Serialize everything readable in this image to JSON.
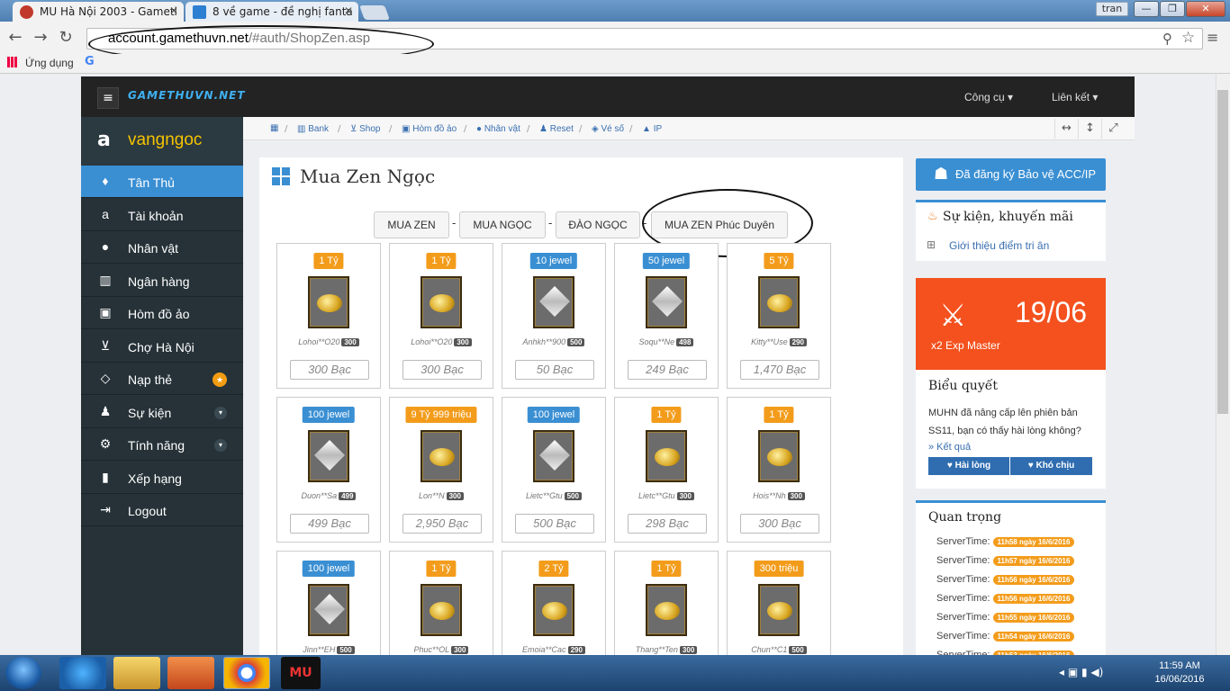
{
  "browser": {
    "tabs": [
      {
        "label": "MU Hà Nội 2003 - Gametl",
        "active": true
      },
      {
        "label": "8 về game - đề nghị fanta",
        "active": false
      }
    ],
    "window_user": "tran",
    "url_host": "account.gamethuvn.net",
    "url_path": "/#auth/ShopZen.asp",
    "bookmarks_label": "Ứng dụng"
  },
  "site": {
    "logo": "GAMETHUVN.NET",
    "top_menu": [
      "Công cụ",
      "Liên kết"
    ],
    "user": "vangngoc",
    "sidebar": [
      {
        "label": "Tân Thủ",
        "icon": "newbie-icon",
        "glyph": "♦",
        "active": true
      },
      {
        "label": "Tài khoản",
        "icon": "account-icon",
        "glyph": "a"
      },
      {
        "label": "Nhân vật",
        "icon": "user-icon",
        "glyph": "●"
      },
      {
        "label": "Ngân hàng",
        "icon": "bank-icon",
        "glyph": "▥"
      },
      {
        "label": "Hòm đồ ảo",
        "icon": "briefcase-icon",
        "glyph": "▣"
      },
      {
        "label": "Chợ Hà Nội",
        "icon": "cart-icon",
        "glyph": "⊻"
      },
      {
        "label": "Nạp thẻ",
        "icon": "diamond-icon",
        "glyph": "◇",
        "badge": "★"
      },
      {
        "label": "Sự kiện",
        "icon": "android-icon",
        "glyph": "♟",
        "chevron": true
      },
      {
        "label": "Tính năng",
        "icon": "gears-icon",
        "glyph": "⚙",
        "chevron": true
      },
      {
        "label": "Xếp hạng",
        "icon": "chart-icon",
        "glyph": "▮"
      },
      {
        "label": "Logout",
        "icon": "logout-icon",
        "glyph": "⇥"
      }
    ],
    "breadcrumb": [
      "Bank",
      "Shop",
      "Hòm đồ ảo",
      "Nhân vật",
      "Reset",
      "Vé số",
      "IP"
    ],
    "page_title": "Mua Zen Ngọc",
    "shop_tabs": [
      "MUA ZEN",
      "MUA NGỌC",
      "ĐÀO NGỌC",
      "MUA ZEN Phúc Duyên"
    ],
    "items": [
      {
        "amount": "1 Tỷ",
        "type": "zen",
        "seller": "Lohoi**O20",
        "level": "300",
        "price": "300 Bạc"
      },
      {
        "amount": "1 Tỷ",
        "type": "zen",
        "seller": "Lohoi**O20",
        "level": "300",
        "price": "300 Bạc"
      },
      {
        "amount": "10 jewel",
        "type": "jewel",
        "seller": "Anhkh**900",
        "level": "500",
        "price": "50 Bạc"
      },
      {
        "amount": "50 jewel",
        "type": "jewel",
        "seller": "Soqu**Ne",
        "level": "498",
        "price": "249 Bạc"
      },
      {
        "amount": "5 Tỷ",
        "type": "zen",
        "seller": "Kitty**Use",
        "level": "290",
        "price": "1,470 Bạc"
      },
      {
        "amount": "100 jewel",
        "type": "jewel",
        "seller": "Duon**Sa",
        "level": "499",
        "price": "499 Bạc"
      },
      {
        "amount": "9 Tỷ 999 triệu",
        "type": "zen",
        "seller": "Lon**N",
        "level": "300",
        "price": "2,950 Bạc"
      },
      {
        "amount": "100 jewel",
        "type": "jewel",
        "seller": "Lietc**Gtu",
        "level": "500",
        "price": "500 Bạc"
      },
      {
        "amount": "1 Tỷ",
        "type": "zen",
        "seller": "Lietc**Gtu",
        "level": "300",
        "price": "298 Bạc"
      },
      {
        "amount": "1 Tỷ",
        "type": "zen",
        "seller": "Hois**Nh",
        "level": "300",
        "price": "300 Bạc"
      },
      {
        "amount": "100 jewel",
        "type": "jewel",
        "seller": "Jinn**EH",
        "level": "500",
        "price": ""
      },
      {
        "amount": "1 Tỷ",
        "type": "zen",
        "seller": "Phuc**OL",
        "level": "300",
        "price": ""
      },
      {
        "amount": "2 Tỷ",
        "type": "zen",
        "seller": "Emoia**Cac",
        "level": "290",
        "price": ""
      },
      {
        "amount": "1 Tỷ",
        "type": "zen",
        "seller": "Thang**Ten",
        "level": "300",
        "price": ""
      },
      {
        "amount": "300 triệu",
        "type": "zen",
        "seller": "Chun**C1",
        "level": "500",
        "price": ""
      }
    ],
    "right": {
      "protect_button": "Đã đăng ký Bảo vệ ACC/IP",
      "events_title": "Sự kiện, khuyến mãi",
      "events_link": "Giới thiệu điểm tri ân",
      "promo_date": "19/06",
      "promo_text": "x2 Exp Master",
      "poll_title": "Biểu quyết",
      "poll_question": "MUHN đã nâng cấp lên phiên bản SS11, bạn có thấy hài lòng không?",
      "poll_result": "» Kết quả",
      "poll_yes": "♥ Hài lòng",
      "poll_no": "♥ Khó chịu",
      "important_title": "Quan trọng",
      "server_label": "ServerTime:",
      "server_times": [
        "11h58 ngày 16/6/2016",
        "11h57 ngày 16/6/2016",
        "11h56 ngày 16/6/2016",
        "11h56 ngày 16/6/2016",
        "11h55 ngày 16/6/2016",
        "11h54 ngày 16/6/2016",
        "11h53 ngày 16/6/2016"
      ]
    }
  },
  "taskbar": {
    "time": "11:59 AM",
    "date": "16/06/2016"
  }
}
